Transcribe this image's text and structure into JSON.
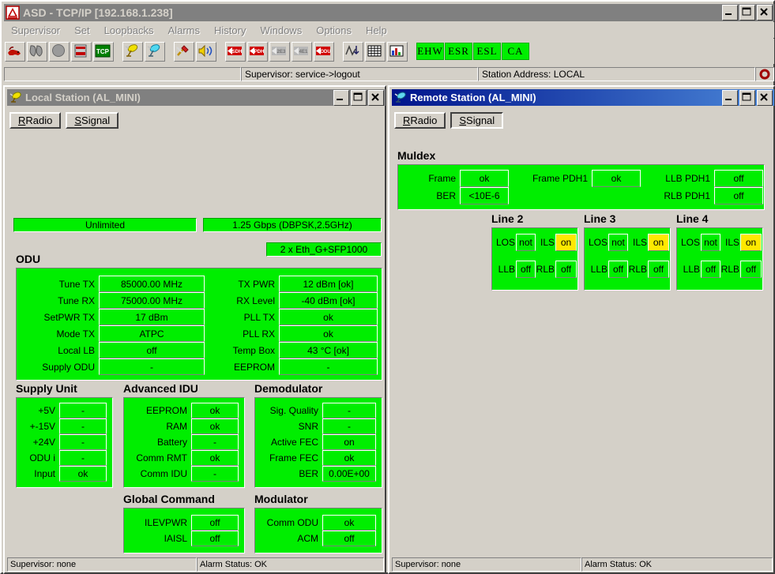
{
  "app": {
    "title": "ASD - TCP/IP [192.168.1.238]",
    "icon": "app-logo-icon",
    "window_buttons": {
      "minimize": "_",
      "maximize": "□",
      "close": "✕"
    }
  },
  "menu": {
    "items": [
      {
        "label": "Supervisor"
      },
      {
        "label": "Set"
      },
      {
        "label": "Loopbacks"
      },
      {
        "label": "Alarms"
      },
      {
        "label": "History"
      },
      {
        "label": "Windows"
      },
      {
        "label": "Options"
      },
      {
        "label": "Help"
      }
    ]
  },
  "toolbar": {
    "buttons": [
      {
        "name": "connect-icon"
      },
      {
        "name": "disconnect-icon"
      },
      {
        "name": "stop-icon"
      },
      {
        "name": "database-icon"
      },
      {
        "name": "tcp-icon",
        "label": "TCP"
      },
      {
        "name": "local-station-icon"
      },
      {
        "name": "remote-station-icon"
      },
      {
        "name": "configure-icon"
      },
      {
        "name": "alarm-sound-icon"
      },
      {
        "name": "sdh-icon",
        "label": "SDH"
      },
      {
        "name": "pdh-icon",
        "label": "PDH"
      },
      {
        "name": "e3-icon",
        "label": "2E3"
      },
      {
        "name": "e1-icon",
        "label": "4E1"
      },
      {
        "name": "odu-icon",
        "label": "ODU"
      },
      {
        "name": "performance-icon"
      },
      {
        "name": "table-icon"
      },
      {
        "name": "chart-icon"
      }
    ],
    "indicators": [
      {
        "label": "EHW",
        "color": "#00ee00"
      },
      {
        "label": "ESR",
        "color": "#00ee00"
      },
      {
        "label": "ESL",
        "color": "#00ee00"
      },
      {
        "label": "CA",
        "color": "#00ee00"
      }
    ]
  },
  "main_status": {
    "left": "",
    "supervisor": "Supervisor: service->logout",
    "station_address": "Station Address: LOCAL",
    "led": "red-led-icon"
  },
  "local_window": {
    "title": "Local Station (AL_MINI)",
    "icon": "local-station-icon",
    "window_buttons": {
      "minimize": "_",
      "maximize": "□",
      "close": "✕"
    },
    "tabs": [
      {
        "label": "Radio",
        "accel": "R",
        "active": true
      },
      {
        "label": "Signal",
        "accel": "S",
        "active": false
      }
    ],
    "banner_left": "Unlimited",
    "banner_right": "1.25 Gbps (DBPSK,2.5GHz)",
    "banner_sfp": "2 x Eth_G+SFP1000",
    "odu": {
      "heading": "ODU",
      "left_fields": [
        {
          "label": "Tune TX",
          "value": "85000.00 MHz"
        },
        {
          "label": "Tune RX",
          "value": "75000.00 MHz"
        },
        {
          "label": "SetPWR TX",
          "value": "17 dBm"
        },
        {
          "label": "Mode TX",
          "value": "ATPC"
        },
        {
          "label": "Local LB",
          "value": "off"
        },
        {
          "label": "Supply ODU",
          "value": "-"
        }
      ],
      "right_fields": [
        {
          "label": "TX PWR",
          "value": "12 dBm [ok]"
        },
        {
          "label": "RX Level",
          "value": "-40 dBm [ok]"
        },
        {
          "label": "PLL TX",
          "value": "ok"
        },
        {
          "label": "PLL RX",
          "value": "ok"
        },
        {
          "label": "Temp Box",
          "value": "43 °C [ok]"
        },
        {
          "label": "EEPROM",
          "value": "-"
        }
      ]
    },
    "supply_unit": {
      "heading": "Supply Unit",
      "fields": [
        {
          "label": "+5V",
          "value": "-"
        },
        {
          "label": "+-15V",
          "value": "-"
        },
        {
          "label": "+24V",
          "value": "-"
        },
        {
          "label": "ODU i",
          "value": "-"
        },
        {
          "label": "Input",
          "value": "ok"
        }
      ]
    },
    "advanced_idu": {
      "heading": "Advanced IDU",
      "fields": [
        {
          "label": "EEPROM",
          "value": "ok"
        },
        {
          "label": "RAM",
          "value": "ok"
        },
        {
          "label": "Battery",
          "value": "-"
        },
        {
          "label": "Comm RMT",
          "value": "ok"
        },
        {
          "label": "Comm IDU",
          "value": "-"
        }
      ]
    },
    "demodulator": {
      "heading": "Demodulator",
      "fields": [
        {
          "label": "Sig. Quality",
          "value": "-"
        },
        {
          "label": "SNR",
          "value": "-"
        },
        {
          "label": "Active FEC",
          "value": "on"
        },
        {
          "label": "Frame FEC",
          "value": "ok"
        },
        {
          "label": "BER",
          "value": "0.00E+00"
        }
      ]
    },
    "global_command": {
      "heading": "Global Command",
      "fields": [
        {
          "label": "ILEVPWR",
          "value": "off"
        },
        {
          "label": "IAISL",
          "value": "off"
        }
      ]
    },
    "modulator": {
      "heading": "Modulator",
      "fields": [
        {
          "label": "Comm ODU",
          "value": "ok"
        },
        {
          "label": "ACM",
          "value": "off"
        }
      ]
    },
    "status": {
      "supervisor": "Supervisor: none",
      "alarm": "Alarm Status: OK"
    }
  },
  "remote_window": {
    "title": "Remote Station (AL_MINI)",
    "icon": "remote-station-icon",
    "window_buttons": {
      "minimize": "_",
      "maximize": "□",
      "close": "✕"
    },
    "tabs": [
      {
        "label": "Radio",
        "accel": "R",
        "active": false
      },
      {
        "label": "Signal",
        "accel": "S",
        "active": true
      }
    ],
    "muldex": {
      "heading": "Muldex",
      "col1": [
        {
          "label": "Frame",
          "value": "ok"
        },
        {
          "label": "BER",
          "value": "<10E-6"
        }
      ],
      "col2": [
        {
          "label": "Frame PDH1",
          "value": "ok"
        }
      ],
      "col3": [
        {
          "label": "LLB PDH1",
          "value": "off"
        },
        {
          "label": "RLB PDH1",
          "value": "off"
        }
      ]
    },
    "lines": [
      {
        "heading": "Line 2",
        "fields": [
          {
            "label": "LOS",
            "value": "not",
            "highlight": false
          },
          {
            "label": "ILS",
            "value": "on",
            "highlight": true
          },
          {
            "label": "LLB",
            "value": "off",
            "highlight": false
          },
          {
            "label": "RLB",
            "value": "off",
            "highlight": false
          }
        ]
      },
      {
        "heading": "Line 3",
        "fields": [
          {
            "label": "LOS",
            "value": "not",
            "highlight": false
          },
          {
            "label": "ILS",
            "value": "on",
            "highlight": true
          },
          {
            "label": "LLB",
            "value": "off",
            "highlight": false
          },
          {
            "label": "RLB",
            "value": "off",
            "highlight": false
          }
        ]
      },
      {
        "heading": "Line 4",
        "fields": [
          {
            "label": "LOS",
            "value": "not",
            "highlight": false
          },
          {
            "label": "ILS",
            "value": "on",
            "highlight": true
          },
          {
            "label": "LLB",
            "value": "off",
            "highlight": false
          },
          {
            "label": "RLB",
            "value": "off",
            "highlight": false
          }
        ]
      }
    ],
    "status": {
      "supervisor": "Supervisor: none",
      "alarm": "Alarm Status: OK"
    }
  },
  "colors": {
    "face": "#d4d0c8",
    "green_ok": "#00ee00",
    "yellow_warn": "#ffe800",
    "title_inactive": "#808080",
    "title_active": "#00148c",
    "red_led": "#a00000"
  }
}
